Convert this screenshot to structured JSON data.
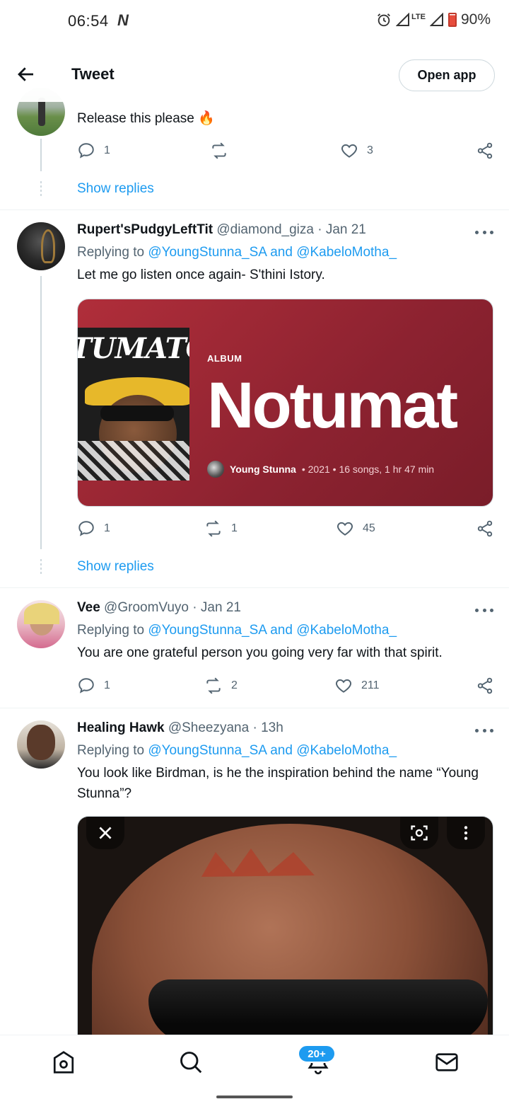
{
  "status_bar": {
    "time": "06:54",
    "network_glyph": "N",
    "lte": "LTE",
    "battery": "90%"
  },
  "header": {
    "title": "Tweet",
    "open_app_label": "Open app"
  },
  "tweets": [
    {
      "text": "Release this please 🔥",
      "replies": "1",
      "retweets": "",
      "likes": "3",
      "show_replies": "Show replies"
    },
    {
      "name": "Rupert'sPudgyLeftTit",
      "handle": "@diamond_giza",
      "date": "· Jan 21",
      "replying_prefix": "Replying to",
      "mention1": "@YoungStunna_SA",
      "and": "and",
      "mention2": "@KabeloMotha_",
      "text": "Let me go listen once again- S'thini Istory.",
      "card": {
        "cover_title": "TUMATO",
        "label": "ALBUM",
        "title": "Notumat",
        "artist": "Young Stunna",
        "details": "• 2021 • 16 songs, 1 hr 47 min"
      },
      "replies": "1",
      "retweets": "1",
      "likes": "45",
      "show_replies": "Show replies"
    },
    {
      "name": "Vee",
      "handle": "@GroomVuyo",
      "date": "· Jan 21",
      "replying_prefix": "Replying to",
      "mention1": "@YoungStunna_SA",
      "and": "and",
      "mention2": "@KabeloMotha_",
      "text": "You are one grateful person you going very far with that spirit.",
      "replies": "1",
      "retweets": "2",
      "likes": "211"
    },
    {
      "name": "Healing Hawk",
      "handle": "@Sheezyana",
      "date": "· 13h",
      "replying_prefix": "Replying to",
      "mention1": "@YoungStunna_SA",
      "and": "and",
      "mention2": "@KabeloMotha_",
      "text": "You look like Birdman, is he the inspiration behind the name “Young Stunna”?"
    }
  ],
  "bottom_nav": {
    "notifications_badge": "20+"
  },
  "colors": {
    "accent": "#1d9bf0",
    "text": "#0f1419",
    "secondary": "#536471",
    "border": "#cfd9de"
  }
}
